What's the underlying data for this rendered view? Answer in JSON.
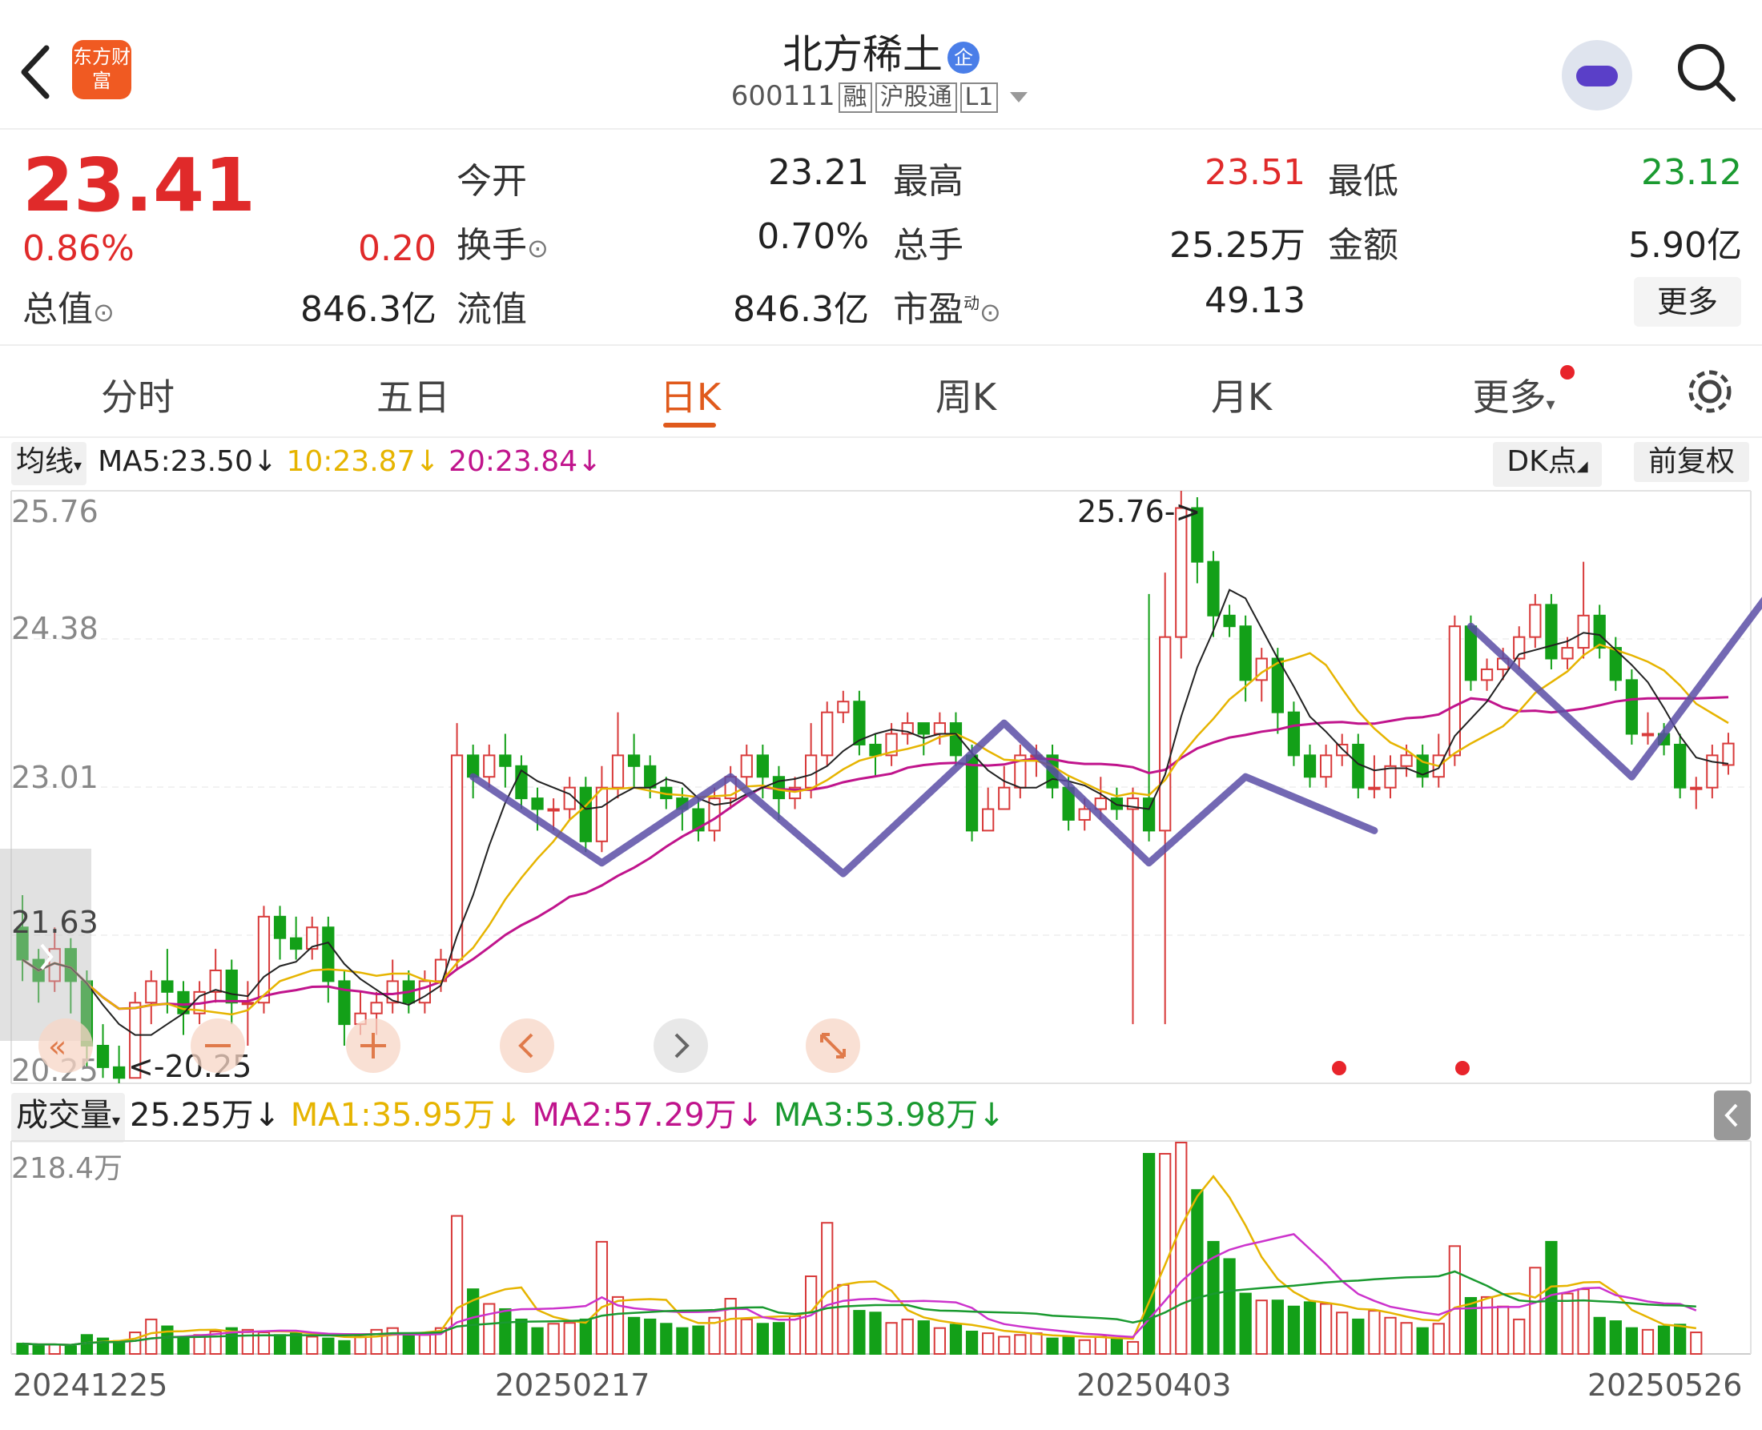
{
  "header": {
    "back_icon": "chevron-left-icon",
    "logo_text": "东方财富",
    "stock_name": "北方稀土",
    "badge": "企",
    "code": "600111",
    "tags": [
      "融",
      "沪股通",
      "L1"
    ]
  },
  "quote": {
    "price": "23.41",
    "change_pct": "0.86%",
    "change": "0.20",
    "fields": {
      "open_label": "今开",
      "open": "23.21",
      "high_label": "最高",
      "high": "23.51",
      "low_label": "最低",
      "low": "23.12",
      "turnover_label": "换手",
      "turnover": "0.70%",
      "volume_label": "总手",
      "volume": "25.25万",
      "amount_label": "金额",
      "amount": "5.90亿",
      "mktcap_label": "总值",
      "mktcap": "846.3亿",
      "float_label": "流值",
      "float": "846.3亿",
      "pe_label": "市盈",
      "pe_sup": "动",
      "pe": "49.13"
    },
    "more_label": "更多"
  },
  "tabs": {
    "items": [
      "分时",
      "五日",
      "日K",
      "周K",
      "月K",
      "更多"
    ],
    "active": "日K"
  },
  "ma_bar": {
    "selector": "均线",
    "ma5": "MA5:23.50↓",
    "ma10": "10:23.87↓",
    "ma20": "20:23.84↓",
    "dk_label": "DK点",
    "adjust_label": "前复权"
  },
  "kline": {
    "y_labels": [
      "25.76",
      "24.38",
      "23.01",
      "20.25"
    ],
    "partial_label": "21.63",
    "max_marker": "25.76->",
    "min_marker": "<-20.25",
    "controls": [
      "fast-back-icon",
      "zoom-out-icon",
      "zoom-in-icon",
      "step-left-icon",
      "step-right-icon",
      "expand-icon"
    ]
  },
  "volume_bar": {
    "selector": "成交量",
    "value": "25.25万↓",
    "ma1": "MA1:35.95万↓",
    "ma2": "MA2:57.29万↓",
    "ma3": "MA3:53.98万↓",
    "max_label": "218.4万"
  },
  "x_axis": [
    "20241225",
    "20250217",
    "20250403",
    "20250526"
  ],
  "colors": {
    "up": "#d83a3a",
    "down": "#13a018",
    "ma5": "#222222",
    "ma10": "#e6b400",
    "ma20": "#c0148c",
    "accent": "#e05a1c",
    "annotation": "#5b4ea6"
  },
  "chart_data": {
    "type": "candlestick",
    "y_range": [
      20.25,
      25.76
    ],
    "price_ticks": [
      "25.76",
      "24.38",
      "23.01",
      "20.25"
    ],
    "max": 25.76,
    "min": 20.25,
    "volume_max": "218.4万",
    "x_labels": [
      "20241225",
      "20250217",
      "20250403",
      "20250526"
    ],
    "series": [
      {
        "name": "MA5",
        "last": 23.5
      },
      {
        "name": "10",
        "last": 23.87
      },
      {
        "name": "20",
        "last": 23.84
      }
    ],
    "volume_series": [
      {
        "name": "MA1",
        "last": "35.95万"
      },
      {
        "name": "MA2",
        "last": "57.29万"
      },
      {
        "name": "MA3",
        "last": "53.98万"
      }
    ],
    "candles": [
      [
        21.7,
        21.4,
        22.0,
        21.2
      ],
      [
        21.4,
        21.2,
        21.5,
        21.0
      ],
      [
        21.2,
        21.5,
        21.7,
        21.1
      ],
      [
        21.5,
        21.2,
        21.6,
        20.9
      ],
      [
        21.2,
        20.6,
        21.3,
        20.4
      ],
      [
        20.6,
        20.4,
        20.8,
        20.3
      ],
      [
        20.4,
        20.3,
        20.6,
        20.25
      ],
      [
        20.3,
        21.0,
        21.1,
        20.3
      ],
      [
        21.0,
        21.2,
        21.3,
        20.8
      ],
      [
        21.2,
        21.1,
        21.5,
        20.9
      ],
      [
        21.1,
        20.9,
        21.2,
        20.7
      ],
      [
        20.9,
        21.1,
        21.2,
        20.8
      ],
      [
        21.1,
        21.3,
        21.5,
        21.0
      ],
      [
        21.3,
        21.0,
        21.4,
        20.8
      ],
      [
        21.0,
        21.0,
        21.2,
        20.6
      ],
      [
        21.0,
        21.8,
        21.9,
        20.9
      ],
      [
        21.8,
        21.6,
        21.9,
        21.4
      ],
      [
        21.6,
        21.5,
        21.8,
        21.4
      ],
      [
        21.5,
        21.7,
        21.8,
        21.4
      ],
      [
        21.7,
        21.2,
        21.8,
        21.0
      ],
      [
        21.2,
        20.8,
        21.3,
        20.6
      ],
      [
        20.8,
        20.9,
        21.1,
        20.7
      ],
      [
        20.9,
        21.0,
        21.1,
        20.7
      ],
      [
        21.0,
        21.2,
        21.4,
        20.9
      ],
      [
        21.2,
        21.0,
        21.3,
        20.9
      ],
      [
        21.0,
        21.2,
        21.3,
        20.9
      ],
      [
        21.2,
        21.4,
        21.5,
        21.1
      ],
      [
        21.4,
        23.3,
        23.6,
        21.3
      ],
      [
        23.3,
        23.1,
        23.4,
        22.9
      ],
      [
        23.1,
        23.3,
        23.4,
        23.0
      ],
      [
        23.3,
        23.2,
        23.5,
        23.0
      ],
      [
        23.2,
        22.9,
        23.3,
        22.8
      ],
      [
        22.9,
        22.8,
        23.0,
        22.6
      ],
      [
        22.8,
        22.8,
        22.9,
        22.6
      ],
      [
        22.8,
        23.0,
        23.1,
        22.7
      ],
      [
        23.0,
        22.5,
        23.1,
        22.4
      ],
      [
        22.5,
        23.0,
        23.2,
        22.4
      ],
      [
        23.0,
        23.3,
        23.7,
        22.9
      ],
      [
        23.3,
        23.2,
        23.5,
        23.0
      ],
      [
        23.2,
        23.0,
        23.3,
        22.9
      ],
      [
        23.0,
        22.9,
        23.1,
        22.8
      ],
      [
        22.9,
        22.8,
        23.0,
        22.6
      ],
      [
        22.8,
        22.6,
        22.9,
        22.5
      ],
      [
        22.6,
        22.9,
        23.0,
        22.5
      ],
      [
        22.9,
        23.1,
        23.2,
        22.8
      ],
      [
        23.1,
        23.3,
        23.4,
        23.0
      ],
      [
        23.3,
        23.1,
        23.4,
        22.9
      ],
      [
        23.1,
        22.9,
        23.2,
        22.7
      ],
      [
        22.9,
        23.0,
        23.1,
        22.8
      ],
      [
        23.0,
        23.3,
        23.6,
        22.9
      ],
      [
        23.3,
        23.7,
        23.8,
        23.2
      ],
      [
        23.7,
        23.8,
        23.9,
        23.6
      ],
      [
        23.8,
        23.4,
        23.9,
        23.3
      ],
      [
        23.4,
        23.3,
        23.5,
        23.1
      ],
      [
        23.3,
        23.5,
        23.6,
        23.2
      ],
      [
        23.5,
        23.6,
        23.7,
        23.4
      ],
      [
        23.6,
        23.5,
        23.6,
        23.3
      ],
      [
        23.5,
        23.6,
        23.7,
        23.4
      ],
      [
        23.6,
        23.3,
        23.7,
        23.2
      ],
      [
        23.3,
        22.6,
        23.4,
        22.5
      ],
      [
        22.6,
        22.8,
        23.0,
        22.6
      ],
      [
        22.8,
        23.0,
        23.2,
        22.8
      ],
      [
        23.0,
        23.3,
        23.4,
        22.9
      ],
      [
        23.3,
        23.3,
        23.4,
        23.1
      ],
      [
        23.3,
        23.0,
        23.4,
        22.9
      ],
      [
        23.0,
        22.7,
        23.1,
        22.6
      ],
      [
        22.7,
        22.8,
        22.9,
        22.6
      ],
      [
        22.8,
        22.9,
        23.1,
        22.7
      ],
      [
        22.9,
        22.8,
        23.0,
        22.7
      ],
      [
        22.8,
        22.9,
        23.0,
        20.8
      ],
      [
        22.9,
        22.6,
        24.8,
        22.5
      ],
      [
        22.6,
        24.4,
        25.0,
        20.8
      ],
      [
        24.4,
        25.6,
        25.76,
        24.2
      ],
      [
        25.6,
        25.1,
        25.7,
        24.9
      ],
      [
        25.1,
        24.6,
        25.2,
        24.4
      ],
      [
        24.6,
        24.5,
        24.7,
        24.4
      ],
      [
        24.5,
        24.0,
        24.6,
        23.8
      ],
      [
        24.0,
        24.2,
        24.3,
        23.8
      ],
      [
        24.2,
        23.7,
        24.3,
        23.5
      ],
      [
        23.7,
        23.3,
        23.8,
        23.2
      ],
      [
        23.3,
        23.1,
        23.4,
        23.0
      ],
      [
        23.1,
        23.3,
        23.4,
        23.0
      ],
      [
        23.3,
        23.4,
        23.5,
        23.2
      ],
      [
        23.4,
        23.0,
        23.5,
        22.9
      ],
      [
        23.0,
        23.0,
        23.3,
        22.9
      ],
      [
        23.0,
        23.2,
        23.3,
        22.9
      ],
      [
        23.2,
        23.3,
        23.4,
        23.1
      ],
      [
        23.3,
        23.1,
        23.4,
        23.0
      ],
      [
        23.1,
        23.3,
        23.5,
        23.0
      ],
      [
        23.3,
        24.5,
        24.6,
        23.2
      ],
      [
        24.5,
        24.0,
        24.6,
        23.9
      ],
      [
        24.0,
        24.1,
        24.2,
        23.9
      ],
      [
        24.1,
        24.2,
        24.3,
        24.0
      ],
      [
        24.2,
        24.4,
        24.5,
        24.1
      ],
      [
        24.4,
        24.7,
        24.8,
        24.3
      ],
      [
        24.7,
        24.2,
        24.8,
        24.1
      ],
      [
        24.2,
        24.3,
        24.4,
        24.1
      ],
      [
        24.3,
        24.6,
        25.1,
        24.2
      ],
      [
        24.6,
        24.3,
        24.7,
        24.2
      ],
      [
        24.3,
        24.0,
        24.4,
        23.9
      ],
      [
        24.0,
        23.5,
        24.1,
        23.4
      ],
      [
        23.5,
        23.5,
        23.7,
        23.4
      ],
      [
        23.5,
        23.4,
        23.6,
        23.3
      ],
      [
        23.4,
        23.0,
        23.5,
        22.9
      ],
      [
        23.0,
        23.0,
        23.1,
        22.8
      ],
      [
        23.0,
        23.3,
        23.4,
        22.9
      ],
      [
        23.21,
        23.41,
        23.51,
        23.12
      ]
    ],
    "volumes": [
      12,
      10,
      11,
      9,
      22,
      18,
      15,
      25,
      40,
      32,
      20,
      22,
      26,
      30,
      28,
      25,
      22,
      24,
      20,
      18,
      15,
      20,
      28,
      30,
      24,
      22,
      30,
      160,
      75,
      58,
      52,
      40,
      30,
      35,
      36,
      40,
      130,
      66,
      42,
      40,
      35,
      30,
      32,
      42,
      64,
      40,
      35,
      36,
      44,
      90,
      152,
      80,
      50,
      48,
      36,
      40,
      38,
      30,
      34,
      26,
      24,
      20,
      22,
      24,
      18,
      20,
      16,
      20,
      18,
      14,
      232,
      232,
      245,
      190,
      130,
      110,
      70,
      62,
      62,
      55,
      60,
      58,
      48,
      40,
      50,
      42,
      36,
      30,
      35,
      125,
      65,
      66,
      55,
      40,
      100,
      130,
      70,
      75,
      42,
      38,
      30,
      28,
      32,
      34,
      25
    ]
  }
}
